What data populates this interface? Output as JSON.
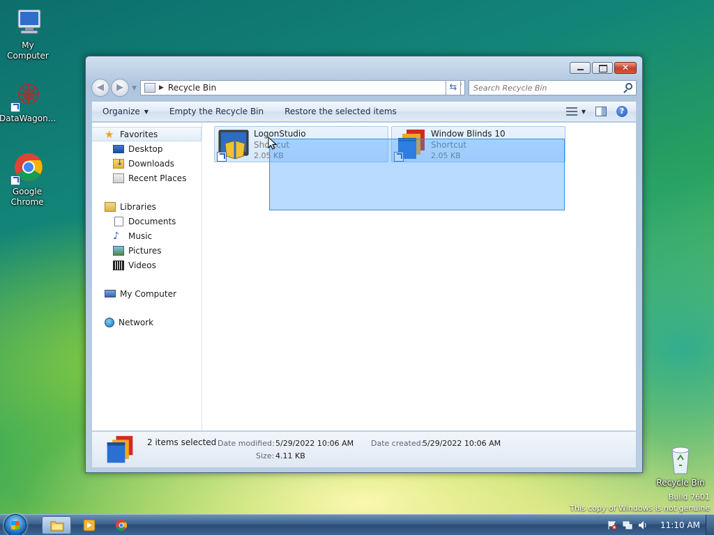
{
  "desktop": {
    "icons": [
      {
        "label": "My Computer"
      },
      {
        "label": "DataWagon..."
      },
      {
        "label": "Google Chrome"
      },
      {
        "label": "Recycle Bin"
      }
    ],
    "watermark": {
      "line1": "Build 7601",
      "line2": "This copy of Windows is not genuine"
    }
  },
  "window": {
    "address": {
      "crumb": "Recycle Bin",
      "search_placeholder": "Search Recycle Bin"
    },
    "toolbar": {
      "organize": "Organize",
      "empty": "Empty the Recycle Bin",
      "restore": "Restore the selected items"
    },
    "navpane": {
      "favorites": {
        "label": "Favorites",
        "items": [
          "Desktop",
          "Downloads",
          "Recent Places"
        ]
      },
      "libraries": {
        "label": "Libraries",
        "items": [
          "Documents",
          "Music",
          "Pictures",
          "Videos"
        ]
      },
      "computer": "My Computer",
      "network": "Network"
    },
    "files": [
      {
        "name": "LogonStudio",
        "type": "Shortcut",
        "size": "2.05 KB"
      },
      {
        "name": "Window Blinds 10",
        "type": "Shortcut",
        "size": "2.05 KB"
      }
    ],
    "details": {
      "count": "2 items selected",
      "modified_label": "Date modified:",
      "modified_value": "5/29/2022 10:06 AM",
      "created_label": "Date created:",
      "created_value": "5/29/2022 10:06 AM",
      "size_label": "Size:",
      "size_value": "4.11 KB"
    }
  },
  "taskbar": {
    "clock": "11:10 AM"
  },
  "colors": {
    "selection": "#3399ff",
    "taskbar": "#2a4c74"
  }
}
